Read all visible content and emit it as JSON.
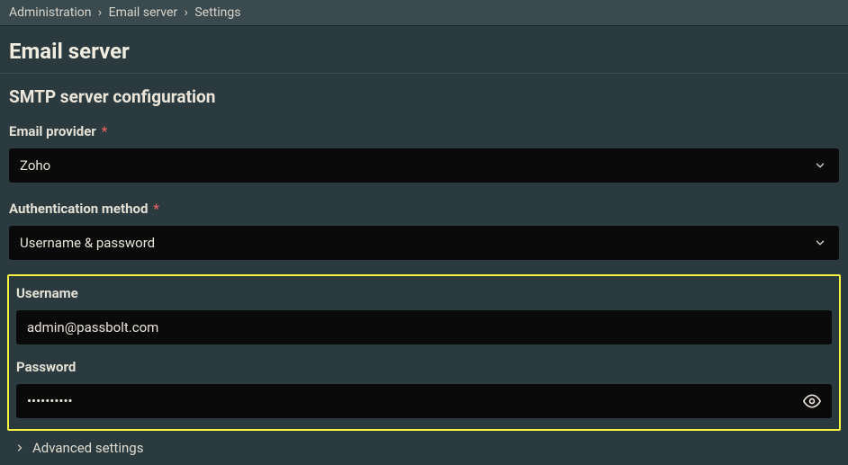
{
  "breadcrumb": {
    "items": [
      "Administration",
      "Email server",
      "Settings"
    ],
    "separator": "›"
  },
  "page": {
    "title": "Email server"
  },
  "section": {
    "title": "SMTP server configuration"
  },
  "fields": {
    "provider": {
      "label": "Email provider",
      "required_marker": "*",
      "value": "Zoho"
    },
    "auth_method": {
      "label": "Authentication method",
      "required_marker": "*",
      "value": "Username & password"
    },
    "username": {
      "label": "Username",
      "value": "admin@passbolt.com"
    },
    "password": {
      "label": "Password",
      "value": "••••••••••"
    }
  },
  "advanced": {
    "label": "Advanced settings"
  }
}
